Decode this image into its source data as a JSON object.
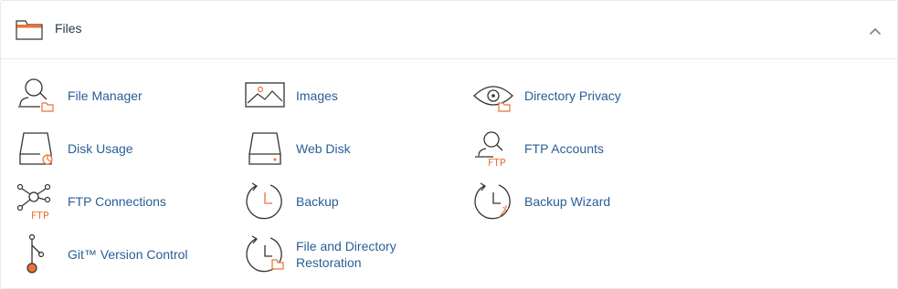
{
  "section": {
    "title": "Files",
    "icons": {
      "header": "folder-icon",
      "collapse": "chevron-up-icon"
    },
    "colors": {
      "accent": "#ec7235",
      "link": "#295e96",
      "icon_stroke": "#333333"
    }
  },
  "items": [
    {
      "label": "File Manager",
      "icon": "file-manager-icon"
    },
    {
      "label": "Images",
      "icon": "images-icon"
    },
    {
      "label": "Directory Privacy",
      "icon": "directory-privacy-icon"
    },
    {
      "label": "Disk Usage",
      "icon": "disk-usage-icon"
    },
    {
      "label": "Web Disk",
      "icon": "web-disk-icon"
    },
    {
      "label": "FTP Accounts",
      "icon": "ftp-accounts-icon"
    },
    {
      "label": "FTP Connections",
      "icon": "ftp-connections-icon"
    },
    {
      "label": "Backup",
      "icon": "backup-icon"
    },
    {
      "label": "Backup Wizard",
      "icon": "backup-wizard-icon"
    },
    {
      "label": "Git™ Version Control",
      "icon": "git-icon"
    },
    {
      "label_line1": "File and Directory",
      "label_line2": "Restoration",
      "icon": "file-restoration-icon"
    }
  ],
  "ftp_badge": "FTP"
}
